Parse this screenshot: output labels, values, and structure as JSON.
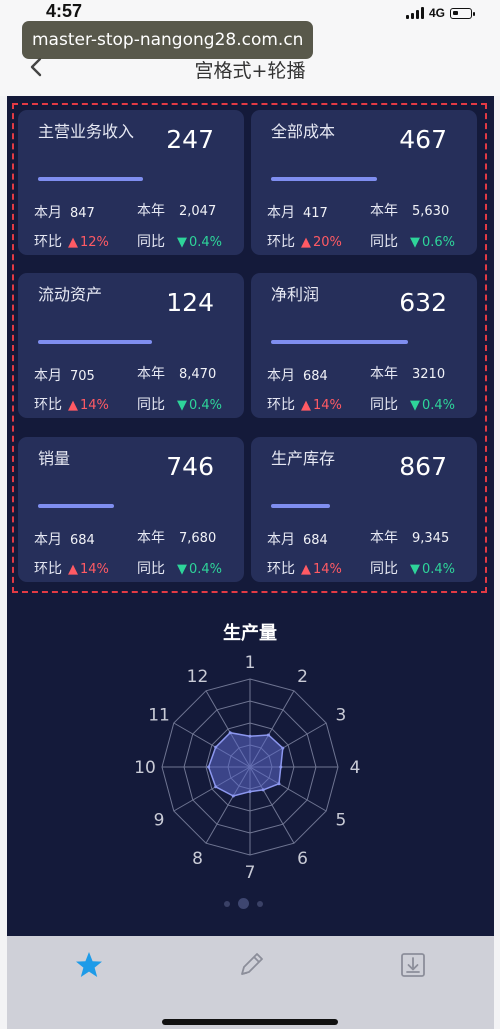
{
  "status": {
    "time": "4:57",
    "network": "4G"
  },
  "nav": {
    "title": "宫格式+轮播",
    "url_banner": "master-stop-nangong28.com.cn"
  },
  "cards": [
    {
      "label": "主营业务收入",
      "value": "247",
      "bar": 0.55,
      "month_label": "本月",
      "month": "847",
      "year_label": "本年",
      "year": "2,047",
      "mom_label": "环比",
      "mom": "12%",
      "mom_dir": "up",
      "yoy_label": "同比",
      "yoy": "0.4%",
      "yoy_dir": "down"
    },
    {
      "label": "全部成本",
      "value": "467",
      "bar": 0.56,
      "month_label": "本月",
      "month": "417",
      "year_label": "本年",
      "year": "5,630",
      "mom_label": "环比",
      "mom": "20%",
      "mom_dir": "up",
      "yoy_label": "同比",
      "yoy": "0.6%",
      "yoy_dir": "down"
    },
    {
      "label": "流动资产",
      "value": "124",
      "bar": 0.6,
      "month_label": "本月",
      "month": "705",
      "year_label": "本年",
      "year": "8,470",
      "mom_label": "环比",
      "mom": "14%",
      "mom_dir": "up",
      "yoy_label": "同比",
      "yoy": "0.4%",
      "yoy_dir": "down"
    },
    {
      "label": "净利润",
      "value": "632",
      "bar": 0.72,
      "month_label": "本月",
      "month": "684",
      "year_label": "本年",
      "year": "3210",
      "mom_label": "环比",
      "mom": "14%",
      "mom_dir": "up",
      "yoy_label": "同比",
      "yoy": "0.4%",
      "yoy_dir": "down"
    },
    {
      "label": "销量",
      "value": "746",
      "bar": 0.4,
      "month_label": "本月",
      "month": "684",
      "year_label": "本年",
      "year": "7,680",
      "mom_label": "环比",
      "mom": "14%",
      "mom_dir": "up",
      "yoy_label": "同比",
      "yoy": "0.4%",
      "yoy_dir": "down"
    },
    {
      "label": "生产库存",
      "value": "867",
      "bar": 0.31,
      "month_label": "本月",
      "month": "684",
      "year_label": "本年",
      "year": "9,345",
      "mom_label": "环比",
      "mom": "14%",
      "mom_dir": "up",
      "yoy_label": "同比",
      "yoy": "0.4%",
      "yoy_dir": "down"
    }
  ],
  "chart_data": {
    "type": "radar",
    "title": "生产量",
    "categories": [
      "1",
      "2",
      "3",
      "4",
      "5",
      "6",
      "7",
      "8",
      "9",
      "10",
      "11",
      "12"
    ],
    "values": [
      0.35,
      0.42,
      0.43,
      0.35,
      0.38,
      0.3,
      0.28,
      0.38,
      0.45,
      0.47,
      0.45,
      0.45
    ],
    "scale_levels": 4,
    "colors": {
      "fill": "#5b67c8",
      "stroke": "#8c97ee",
      "grid": "#6f7592",
      "label": "#c9cbd6"
    }
  },
  "pager": {
    "pages": 3,
    "active": 1
  },
  "tabs": [
    "star-icon",
    "pencil-icon",
    "download-icon"
  ],
  "colors": {
    "up": "#ff5a64",
    "down": "#2ed49a",
    "tab_active": "#1e9be8",
    "tab_inactive": "#8c8e9a"
  }
}
